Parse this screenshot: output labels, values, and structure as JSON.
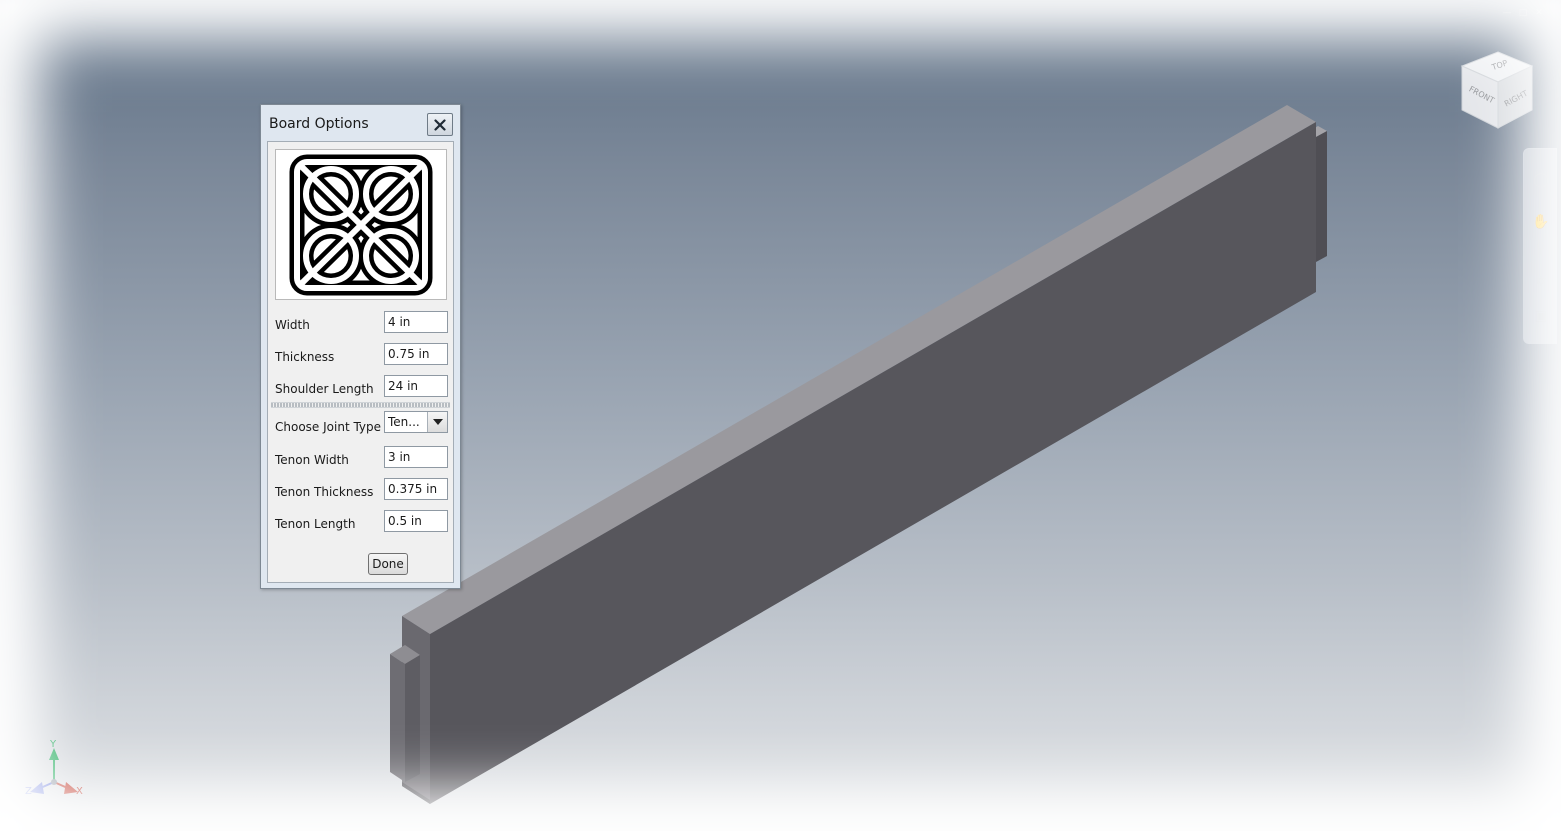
{
  "dialog": {
    "title": "Board Options",
    "close_icon": "close-icon",
    "logo_icon": "celtic-knot-icon",
    "fields": {
      "width": {
        "label": "Width",
        "value": "4 in"
      },
      "thickness": {
        "label": "Thickness",
        "value": "0.75 in"
      },
      "shoulder_length": {
        "label": "Shoulder Length",
        "value": "24 in"
      },
      "joint_type": {
        "label": "Choose Joint Type",
        "value": "Ten..."
      },
      "tenon_width": {
        "label": "Tenon Width",
        "value": "3 in"
      },
      "tenon_thickness": {
        "label": "Tenon Thickness",
        "value": "0.375 in"
      },
      "tenon_length": {
        "label": "Tenon Length",
        "value": "0.5 in"
      }
    },
    "done_label": "Done"
  },
  "viewcube": {
    "top": "TOP",
    "front": "FRONT",
    "right": "RIGHT"
  },
  "triad": {
    "x": "X",
    "y": "Y",
    "z": "Z",
    "x_color": "#c0392b",
    "y_color": "#27ae60",
    "z_color": "#5b6ed8"
  },
  "colors": {
    "board_front": "#57565c",
    "board_top": "#9a999e",
    "background_top": "#5f7186",
    "background_bottom": "#e6e8ea",
    "dialog_frame": "#dfe7f0"
  }
}
